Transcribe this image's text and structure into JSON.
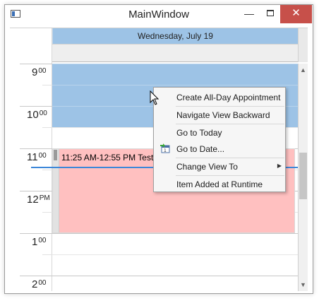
{
  "window": {
    "title": "MainWindow",
    "minimize": "—",
    "close": "✕"
  },
  "scheduler": {
    "day_header": "Wednesday, July 19",
    "hours": [
      {
        "hour": "9",
        "suffix": "00"
      },
      {
        "hour": "10",
        "suffix": "00"
      },
      {
        "hour": "11",
        "suffix": "00"
      },
      {
        "hour": "12",
        "suffix": "PM"
      },
      {
        "hour": "1",
        "suffix": "00"
      },
      {
        "hour": "2",
        "suffix": "00"
      }
    ],
    "appointment": {
      "text": "11:25 AM-12:55 PM Test",
      "color": "#ffc0c0"
    },
    "work_color": "#9dc3e6",
    "now_line_color": "#3c87d9"
  },
  "context_menu": {
    "items": [
      {
        "label": "Create All-Day Appointment"
      },
      {
        "label": "Navigate View Backward"
      },
      {
        "label": "Go to Today"
      },
      {
        "label": "Go to Date...",
        "icon": "calendar-go-icon"
      },
      {
        "label": "Change View To",
        "submenu": true
      },
      {
        "label": "Item Added at Runtime"
      }
    ]
  }
}
